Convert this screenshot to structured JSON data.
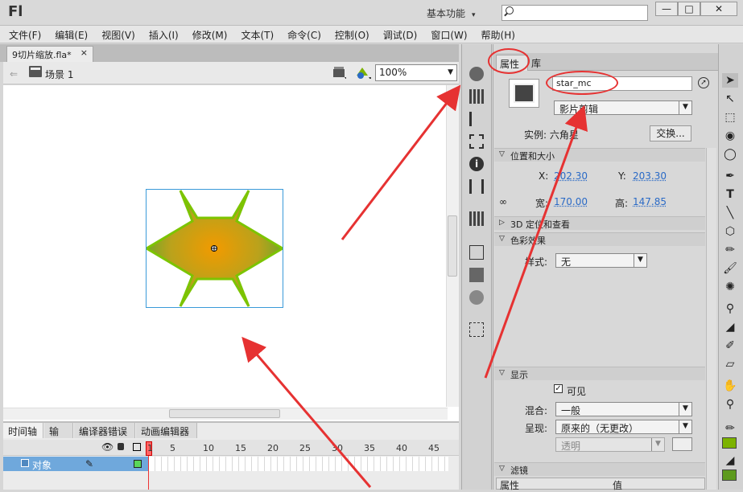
{
  "app": {
    "logo": "Fl",
    "workspace": "基本功能",
    "search_placeholder": ""
  },
  "window_buttons": [
    "—",
    "□",
    "✕"
  ],
  "menu": [
    "文件(F)",
    "编辑(E)",
    "视图(V)",
    "插入(I)",
    "修改(M)",
    "文本(T)",
    "命令(C)",
    "控制(O)",
    "调试(D)",
    "窗口(W)",
    "帮助(H)"
  ],
  "document": {
    "tab_title": "9切片缩放.fla*",
    "close": "×"
  },
  "editbar": {
    "scene": "场景 1",
    "zoom": "100%"
  },
  "timeline": {
    "tabs": [
      "时间轴",
      "输出",
      "编译器错误",
      "动画编辑器"
    ],
    "frame_numbers": [
      "1",
      "5",
      "10",
      "15",
      "20",
      "25",
      "30",
      "35",
      "40",
      "45"
    ],
    "layer": "对象"
  },
  "properties": {
    "tabs": [
      "属性",
      "库"
    ],
    "instance_name": "star_mc",
    "symbol_type": "影片剪辑",
    "instance_of": "实例: 六角星",
    "swap_label": "交换...",
    "sections": {
      "position_size": "位置和大小",
      "three_d": "3D 定位和查看",
      "color_effect": "色彩效果",
      "display": "显示",
      "filters": "滤镜"
    },
    "x_label": "X:",
    "x_value": "202.30",
    "y_label": "Y:",
    "y_value": "203.30",
    "w_label": "宽:",
    "w_value": "170.00",
    "h_label": "高:",
    "h_value": "147.85",
    "style_label": "样式:",
    "style_value": "无",
    "visible_label": "可见",
    "blend_label": "混合:",
    "blend_value": "一般",
    "render_label": "呈现:",
    "render_value": "原来的（无更改）",
    "transparent_value": "透明",
    "filter_col_property": "属性",
    "filter_col_value": "值"
  },
  "colors": {
    "stroke": "#7cb300",
    "fill": "#5d9a1c",
    "star_center": "#f0a000",
    "star_edge": "#5fa82a",
    "annotation": "#e63232"
  }
}
